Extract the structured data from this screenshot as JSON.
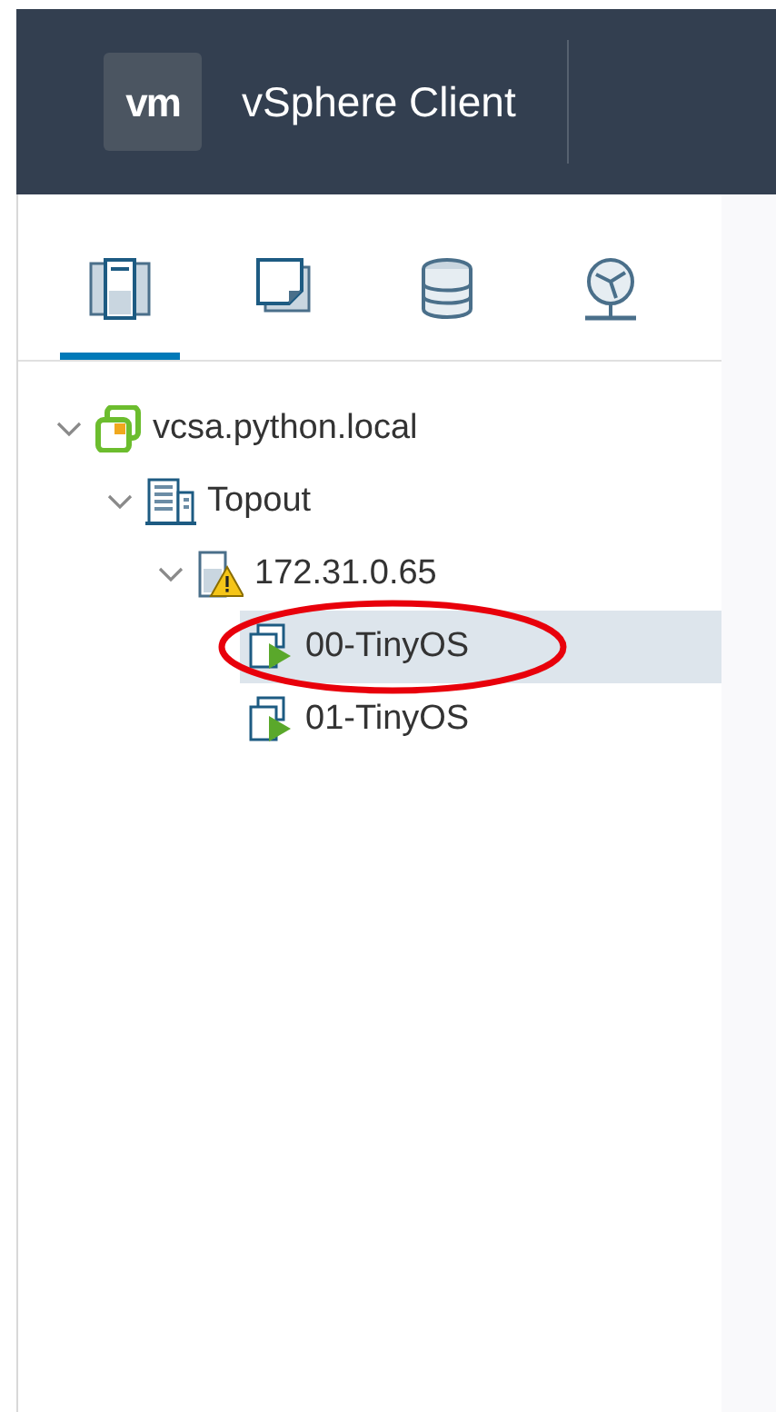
{
  "header": {
    "logo": "vm",
    "title": "vSphere Client"
  },
  "tabs": [
    {
      "kind": "hosts",
      "selected": true
    },
    {
      "kind": "vms",
      "selected": false
    },
    {
      "kind": "storage",
      "selected": false
    },
    {
      "kind": "network",
      "selected": false
    }
  ],
  "tree": [
    {
      "kind": "vcenter",
      "label": "vcsa.python.local",
      "expanded": true,
      "selected": false,
      "children": [
        {
          "kind": "datacenter",
          "label": "Topout",
          "expanded": true,
          "selected": false,
          "children": [
            {
              "kind": "host",
              "label": "172.31.0.65",
              "expanded": true,
              "selected": false,
              "warning": true,
              "children": [
                {
                  "kind": "vm",
                  "label": "00-TinyOS",
                  "selected": true,
                  "powered_on": true,
                  "circled": true
                },
                {
                  "kind": "vm",
                  "label": "01-TinyOS",
                  "selected": false,
                  "powered_on": true,
                  "circled": false
                }
              ]
            }
          ]
        }
      ]
    }
  ]
}
